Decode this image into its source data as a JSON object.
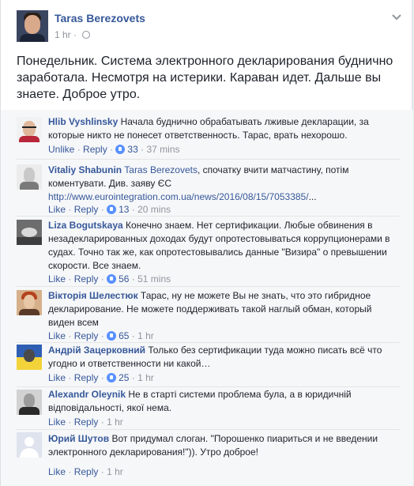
{
  "post": {
    "author": "Taras Berezovets",
    "time": "1 hr",
    "dot": "·",
    "text": "Понедельник. Система электронного декларирования буднично заработала. Несмотря на истерики. Караван идет. Дальше вы знаете. Доброе утро."
  },
  "comments": [
    {
      "author": "Hlib Vyshlinsky",
      "text": "Начала буднично обрабатывать лживые декларации, за которые никто не понесет ответственность. Тарас, врать нехорошо.",
      "action1": "Unlike",
      "action2": "Reply",
      "likes": "33",
      "time": "37 mins"
    },
    {
      "author": "Vitaliy Shabunin",
      "mention": "Taras Berezovets",
      "text": ", спочатку вчити матчастину, потім коментувати. Див. заяву ЄС",
      "link": "http://www.eurointegration.com.ua/news/2016/08/15/7053385/",
      "link_suffix": "...",
      "action1": "Like",
      "action2": "Reply",
      "likes": "13",
      "time": "20 mins"
    },
    {
      "author": "Liza Bogutskaya",
      "text": "Конечно знаем. Нет сертификации. Любые обвинения в незадекларированных доходах будут опротестовываться коррупционерами в судах. Точно так же, как опротестовывались данные \"Визира\" о превышении скорости. Все знаем.",
      "action1": "Like",
      "action2": "Reply",
      "likes": "56",
      "time": "51 mins"
    },
    {
      "author": "Вікторія Шелестюк",
      "text": "Тарас, ну не можете Вы не знать, что это гибридное декларирование. Не можете поддерживать такой наглый обман, который виден всем",
      "action1": "Like",
      "action2": "Reply",
      "likes": "65",
      "time": "1 hr"
    },
    {
      "author": "Андрій Зацерковний",
      "text": "Только без сертификации туда можно писать всё что угодно и ответственности ни какой…",
      "action1": "Like",
      "action2": "Reply",
      "likes": "25",
      "time": "1 hr"
    },
    {
      "author": "Alexandr Oleynik",
      "text": "Не в старті системи проблема була, а в юридичній відповідальності, якої нема.",
      "action1": "Like",
      "action2": "Reply",
      "likes": "",
      "time": "1 hr"
    },
    {
      "author": "Юрий Шутов",
      "text": "Вот придумал слоган. \"Порошенко пиариться и не введении электронного декларирования!\")). Утро доброе!",
      "action1": "Like",
      "action2": "Reply",
      "likes": "",
      "time": "1 hr"
    }
  ],
  "icons": {
    "like": "thumbs-up-icon",
    "privacy": "globe-icon",
    "menu": "chevron-down-icon"
  },
  "colors": {
    "link": "#365899",
    "meta": "#90949c",
    "text": "#1d2129",
    "like_badge": "#5890ff"
  }
}
